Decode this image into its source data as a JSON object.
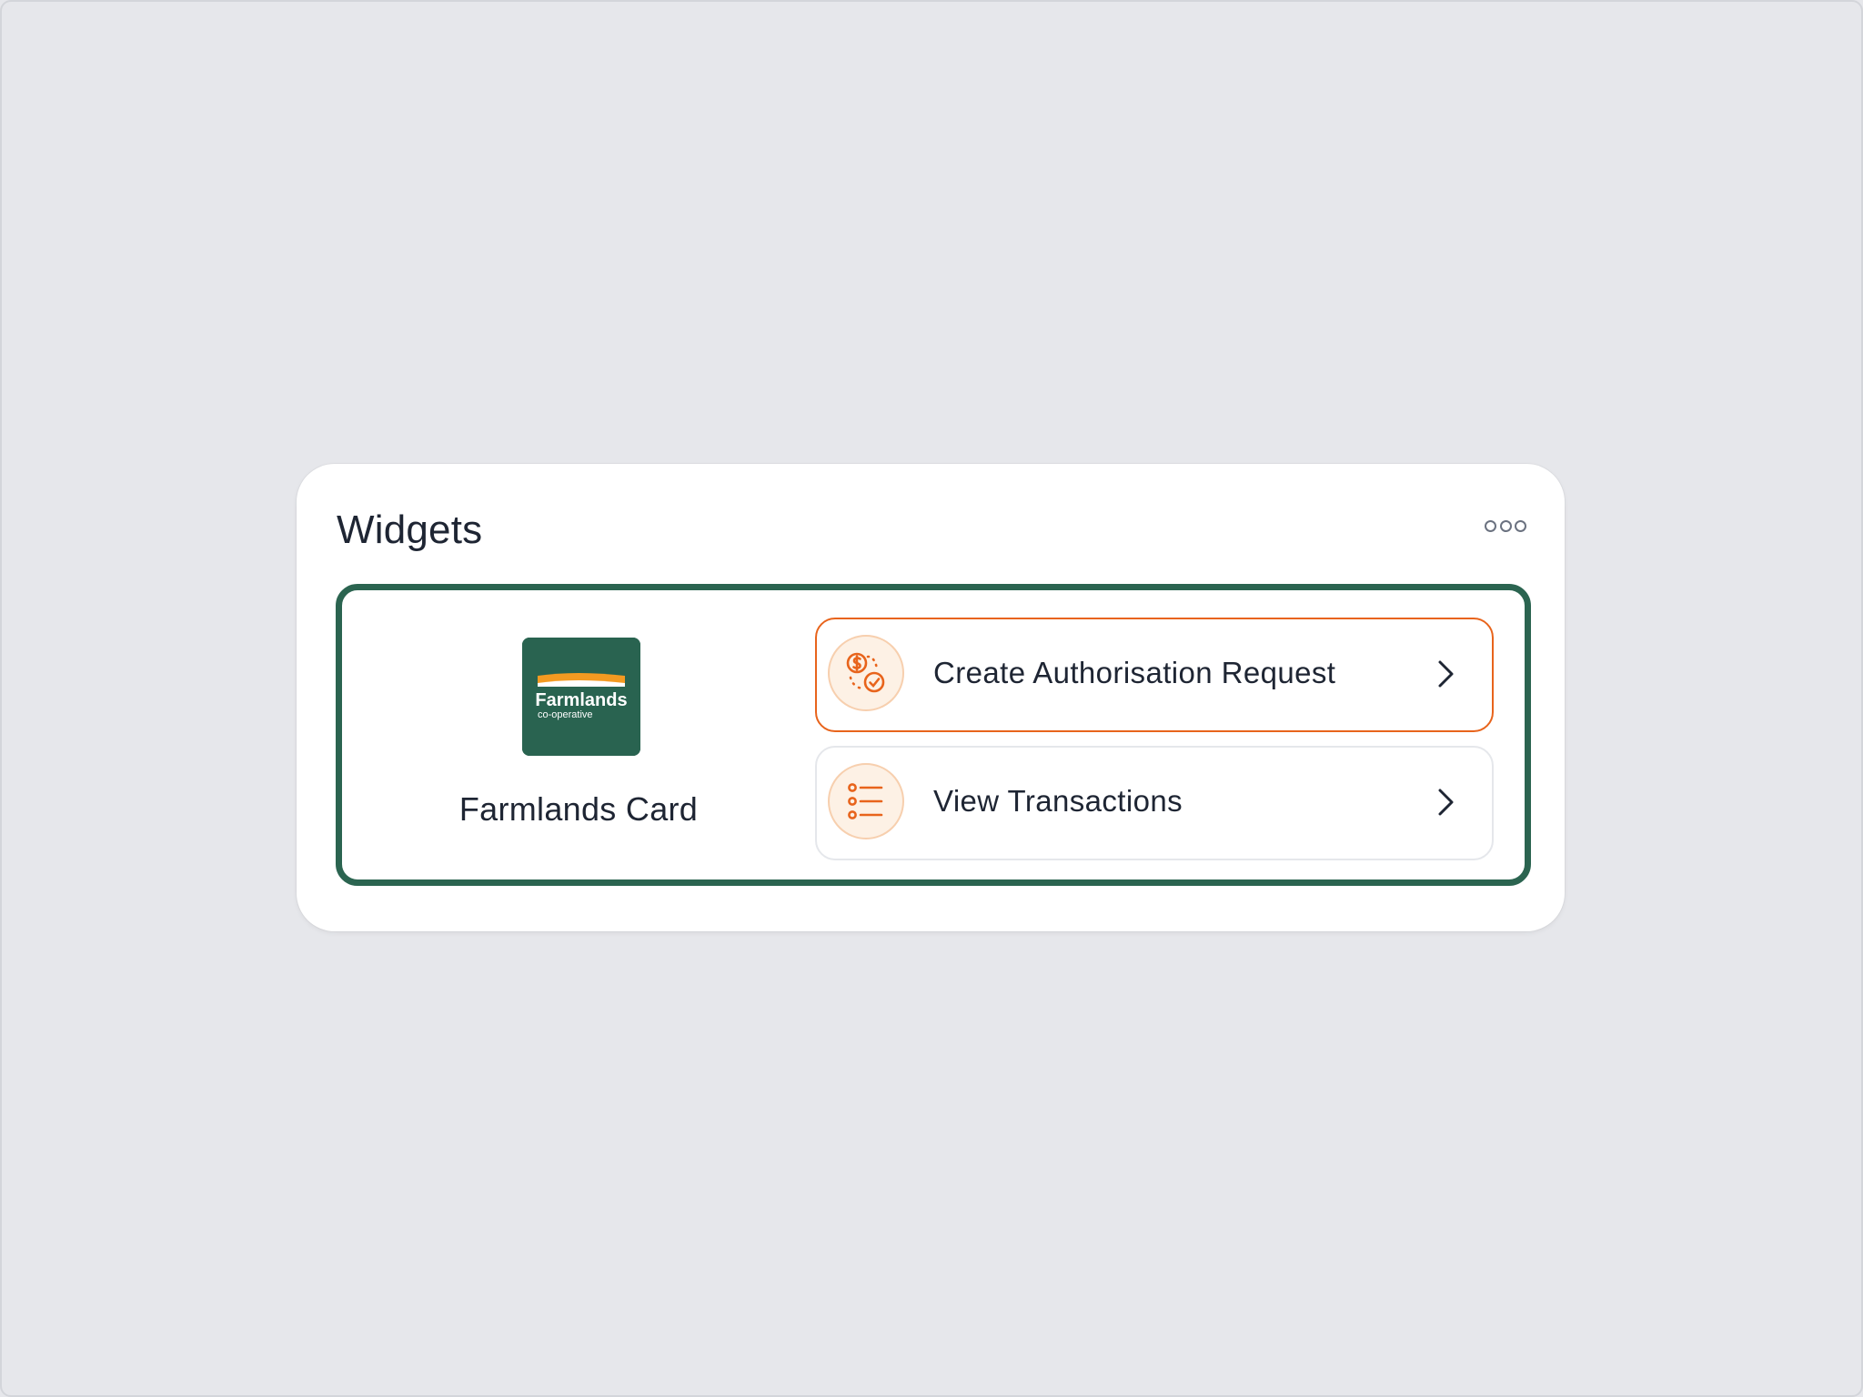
{
  "widget": {
    "title": "Widgets",
    "menu_icon": "more-horizontal-icon"
  },
  "card": {
    "logo": {
      "icon": "farmlands-logo",
      "brand_text": "Farmlands",
      "brand_subtext": "co-operative",
      "colors": {
        "background": "#296350",
        "stripe": "#f39a21",
        "text": "#ffffff"
      }
    },
    "name": "Farmlands Card",
    "border_color": "#2b6450"
  },
  "actions": [
    {
      "label": "Create Authorisation Request",
      "icon": "dollar-check-icon",
      "chevron": "chevron-right-icon",
      "highlighted": true
    },
    {
      "label": "View Transactions",
      "icon": "list-icon",
      "chevron": "chevron-right-icon",
      "highlighted": false
    }
  ],
  "colors": {
    "accent": "#e8641c",
    "icon_background": "#fdf1e5",
    "page_background": "#e6e7eb",
    "text": "#1e2533"
  }
}
